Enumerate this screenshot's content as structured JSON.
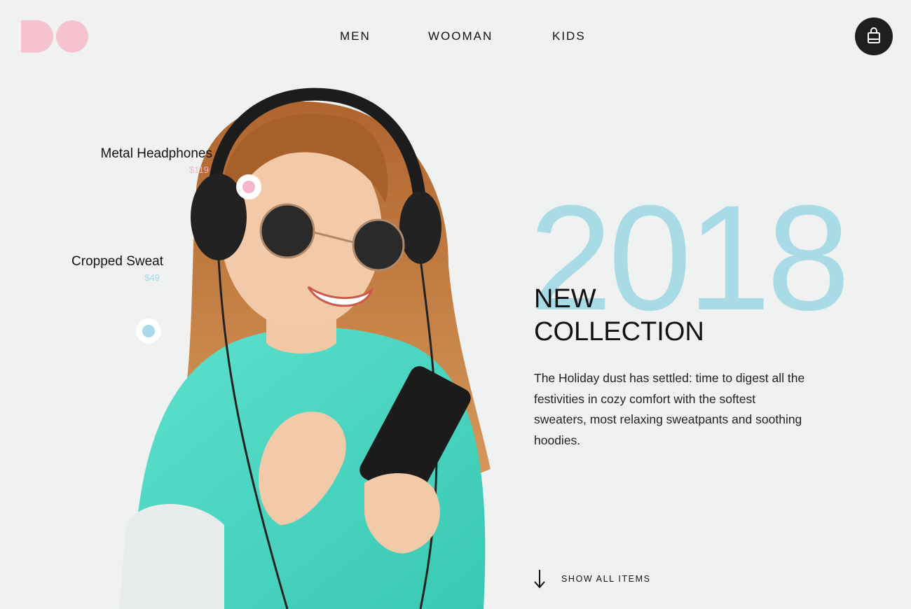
{
  "brand": {
    "color": "#f7c2d0"
  },
  "nav": {
    "items": [
      "MEN",
      "WOOMAN",
      "KIDS"
    ]
  },
  "cart": {
    "icon": "shopping-bag-icon"
  },
  "hotspots": [
    {
      "name": "Metal Headphones",
      "price": "$119",
      "color": "#f4b6c8"
    },
    {
      "name": "Cropped Sweat",
      "price": "$49",
      "color": "#a9d8e6"
    }
  ],
  "hero": {
    "year": "2018",
    "headline_line1": "NEW",
    "headline_line2": "COLLECTION",
    "description": "The Holiday dust has settled: time to digest all the festivities in cozy comfort with the softest sweaters, most relaxing sweatpants and soothing hoodies.",
    "accent_color": "#a9dbe6"
  },
  "cta": {
    "label": "SHOW ALL ITEMS",
    "icon": "arrow-down-icon"
  }
}
